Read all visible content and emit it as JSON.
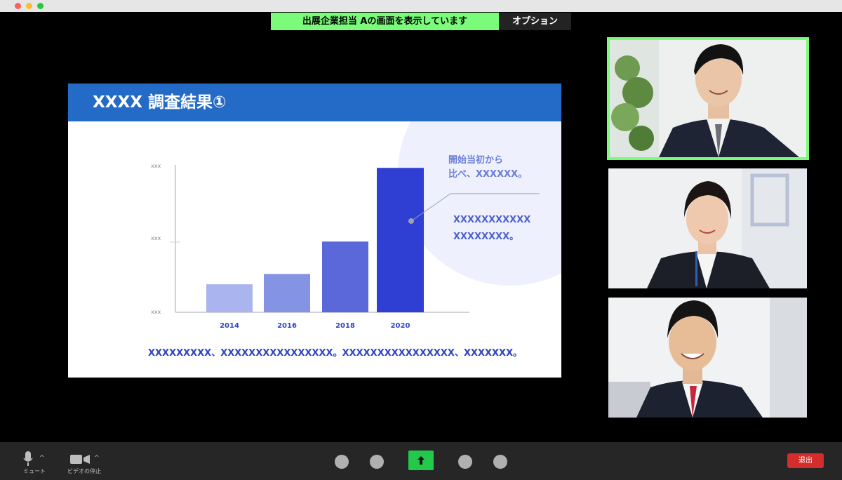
{
  "banner": {
    "text": "出展企業担当 Aの画面を表示しています",
    "options_label": "オプション"
  },
  "slide": {
    "title": "XXXX 調査結果①",
    "callout_head_line1": "開始当初から",
    "callout_head_line2": "比べ、XXXXXX。",
    "callout_body_line1": "XXXXXXXXXXX",
    "callout_body_line2": "XXXXXXXX。",
    "footer": "XXXXXXXXX、XXXXXXXXXXXXXXXX。XXXXXXXXXXXXXXXX、XXXXXXX。"
  },
  "chart_data": {
    "type": "bar",
    "categories": [
      "2014",
      "2016",
      "2018",
      "2020"
    ],
    "values": [
      19,
      26,
      48,
      98
    ],
    "ytick_labels": [
      "xxx",
      "xxx",
      "xxx"
    ],
    "ylim": [
      0,
      100
    ],
    "grid": false,
    "colors": [
      "#aab4ee",
      "#8593e4",
      "#5a68da",
      "#2f3fd3"
    ]
  },
  "toolbar": {
    "mute_label": "ミュート",
    "video_label": "ビデオの停止",
    "exit_label": "退出"
  },
  "colors": {
    "accent_green": "#7afc7a",
    "slide_blue": "#236bc6",
    "exit_red": "#d42d2d",
    "share_green": "#23c94b"
  }
}
